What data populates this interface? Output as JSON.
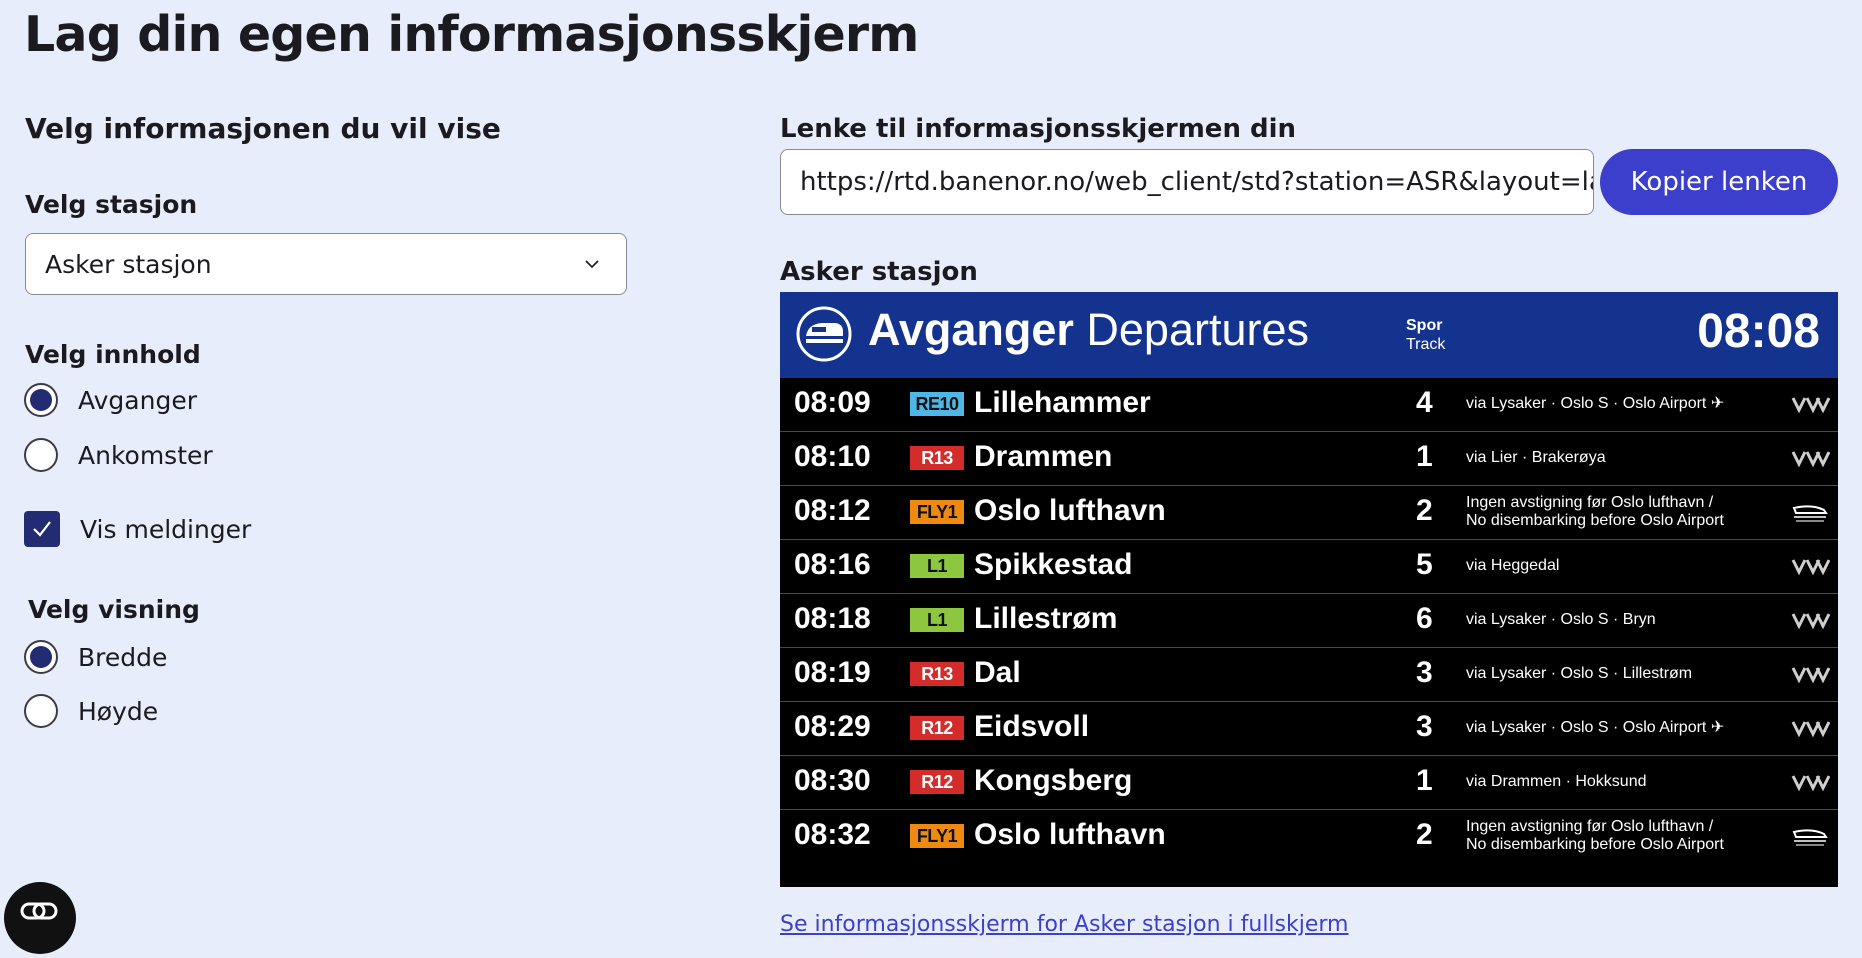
{
  "page": {
    "title": "Lag din egen informasjonsskjerm"
  },
  "left": {
    "heading": "Velg informasjonen du vil vise",
    "station": {
      "label": "Velg stasjon",
      "value": "Asker stasjon"
    },
    "content": {
      "label": "Velg innhold",
      "options": [
        {
          "text": "Avganger",
          "selected": true
        },
        {
          "text": "Ankomster",
          "selected": false
        }
      ],
      "messages_checkbox": {
        "text": "Vis meldinger",
        "checked": true
      }
    },
    "view": {
      "label": "Velg visning",
      "options": [
        {
          "text": "Bredde",
          "selected": true
        },
        {
          "text": "Høyde",
          "selected": false
        }
      ]
    }
  },
  "right": {
    "link_label": "Lenke til informasjonsskjermen din",
    "link_value": "https://rtd.banenor.no/web_client/std?station=ASR&layout=lands",
    "copy_button": "Kopier lenken",
    "preview_label": "Asker stasjon",
    "bottom_link": "Se informasjonsskjerm for Asker stasjon i fullskjerm"
  },
  "board": {
    "title_no": "Avganger",
    "title_en": "Departures",
    "track_no": "Spor",
    "track_en": "Track",
    "clock": "08:08",
    "rows": [
      {
        "time": "08:09",
        "line": "RE10",
        "line_color": "#4fb6e6",
        "dest": "Lillehammer",
        "track": "4",
        "via1": "via Lysaker · Oslo S · Oslo Airport ✈",
        "via2": "",
        "operator": "vy-icon"
      },
      {
        "time": "08:10",
        "line": "R13",
        "line_color": "#d42b2b",
        "dest": "Drammen",
        "track": "1",
        "via1": "via Lier · Brakerøya",
        "via2": "",
        "operator": "vy-icon"
      },
      {
        "time": "08:12",
        "line": "FLY1",
        "line_color": "#ee8a12",
        "dest": "Oslo lufthavn",
        "track": "2",
        "via1": "Ingen avstigning før Oslo lufthavn /",
        "via2": "No disembarking before Oslo Airport",
        "operator": "flytoget-icon"
      },
      {
        "time": "08:16",
        "line": "L1",
        "line_color": "#8dc63f",
        "dest": "Spikkestad",
        "track": "5",
        "via1": "via Heggedal",
        "via2": "",
        "operator": "vy-icon"
      },
      {
        "time": "08:18",
        "line": "L1",
        "line_color": "#8dc63f",
        "dest": "Lillestrøm",
        "track": "6",
        "via1": "via Lysaker · Oslo S · Bryn",
        "via2": "",
        "operator": "vy-icon"
      },
      {
        "time": "08:19",
        "line": "R13",
        "line_color": "#d42b2b",
        "dest": "Dal",
        "track": "3",
        "via1": "via Lysaker · Oslo S · Lillestrøm",
        "via2": "",
        "operator": "vy-icon"
      },
      {
        "time": "08:29",
        "line": "R12",
        "line_color": "#d42b2b",
        "dest": "Eidsvoll",
        "track": "3",
        "via1": "via Lysaker · Oslo S · Oslo Airport ✈",
        "via2": "",
        "operator": "vy-icon"
      },
      {
        "time": "08:30",
        "line": "R12",
        "line_color": "#d42b2b",
        "dest": "Kongsberg",
        "track": "1",
        "via1": "via Drammen · Hokksund",
        "via2": "",
        "operator": "vy-icon"
      },
      {
        "time": "08:32",
        "line": "FLY1",
        "line_color": "#ee8a12",
        "dest": "Oslo lufthavn",
        "track": "2",
        "via1": "Ingen avstigning før Oslo lufthavn /",
        "via2": "No disembarking before Oslo Airport",
        "operator": "flytoget-icon"
      }
    ]
  }
}
